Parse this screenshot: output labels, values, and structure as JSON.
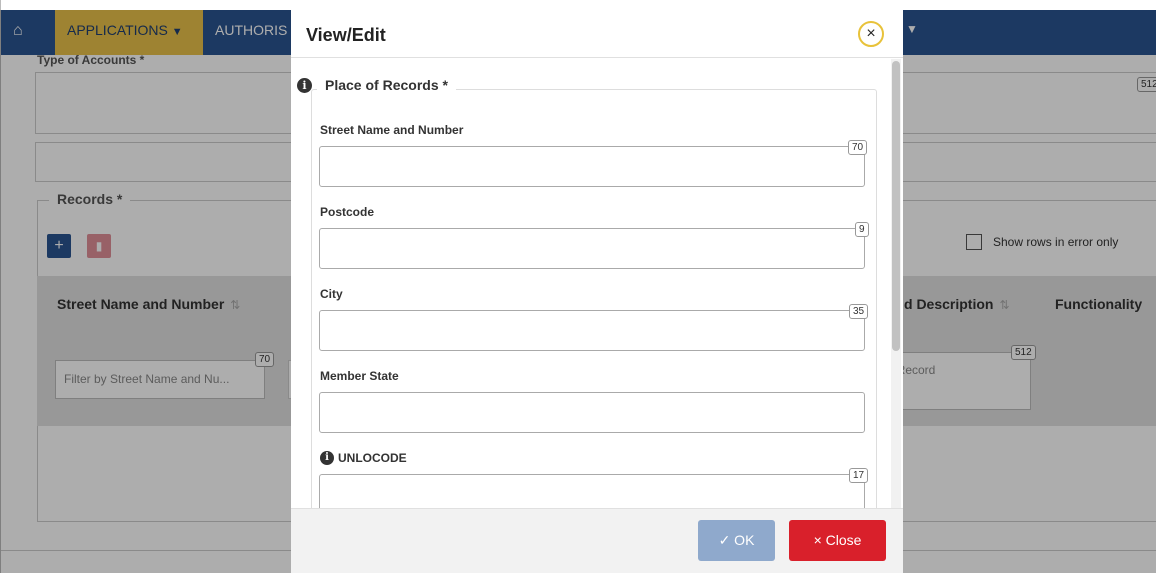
{
  "nav": {
    "applications_label": "APPLICATIONS",
    "authorisations_label": "AUTHORIS",
    "caret": "▼"
  },
  "background": {
    "type_of_accounts_label": "Type of Accounts *",
    "type_of_accounts_counter": "512",
    "records_legend": "Records *",
    "show_errors_label": "Show rows in error only",
    "columns": [
      {
        "label": "Street Name and Number",
        "sort": "⇅"
      },
      {
        "label": "d Description",
        "sort": "⇅"
      },
      {
        "label": "Functionality",
        "sort": ""
      }
    ],
    "filter_street_placeholder": "Filter by Street Name and Nu...",
    "filter_street_counter": "70",
    "filter_record_placeholder": "f Record",
    "filter_record_counter": "512"
  },
  "modal": {
    "title": "View/Edit",
    "close_icon": "×",
    "legend": "Place of Records *",
    "fields": [
      {
        "label": "Street Name and Number",
        "value": "",
        "counter": "70"
      },
      {
        "label": "Postcode",
        "value": "",
        "counter": "9"
      },
      {
        "label": "City",
        "value": "",
        "counter": "35"
      },
      {
        "label": "Member State",
        "value": "",
        "counter": ""
      },
      {
        "label": "UNLOCODE",
        "value": "",
        "counter": "17"
      }
    ],
    "ok_label": "✓  OK",
    "close_label": "×  Close"
  },
  "colors": {
    "nav_blue": "#2a5591",
    "apps_yellow": "#e9c14a",
    "ok_button": "#8fa9cc",
    "close_button": "#d9202b"
  }
}
